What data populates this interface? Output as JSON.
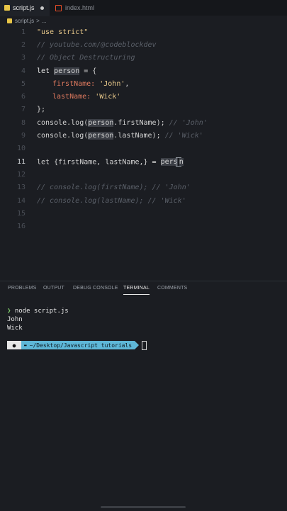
{
  "tabs": [
    {
      "label": "script.js",
      "active": true,
      "modified": true
    },
    {
      "label": "index.html",
      "active": false
    }
  ],
  "breadcrumb": {
    "file": "script.js",
    "sep": ">",
    "more": "..."
  },
  "editor": {
    "lines": [
      {
        "n": "1"
      },
      {
        "n": "2"
      },
      {
        "n": "3"
      },
      {
        "n": "4"
      },
      {
        "n": "5"
      },
      {
        "n": "6"
      },
      {
        "n": "7"
      },
      {
        "n": "8"
      },
      {
        "n": "9"
      },
      {
        "n": "10"
      },
      {
        "n": "11"
      },
      {
        "n": "12"
      },
      {
        "n": "13"
      },
      {
        "n": "14"
      },
      {
        "n": "15"
      },
      {
        "n": "16"
      }
    ],
    "code": {
      "l1": "\"use strict\"",
      "l2": "// youtube.com/@codeblockdev",
      "l3": "// Object Destructuring",
      "l4_kw": "let ",
      "l4_var": "person",
      "l4_rest": " = {",
      "l5_key": "firstName:",
      "l5_val": " 'John'",
      "l5_end": ",",
      "l6_key": "lastName:",
      "l6_val": " 'Wick'",
      "l7": "};",
      "l8_a": "console.log(",
      "l8_b": "person",
      "l8_c": ".firstName); ",
      "l8_cmt": "// 'John'",
      "l9_a": "console.log(",
      "l9_b": "person",
      "l9_c": ".lastName); ",
      "l9_cmt": "// 'Wick'",
      "l11_a": "let {firstName, lastName,} = ",
      "l11_b": "pers",
      "l11_c": "n",
      "l13": "// console.log(firstName); // 'John'",
      "l14": "// console.log(lastName); // 'Wick'"
    },
    "current_line": 11
  },
  "panel": {
    "tabs": [
      "PROBLEMS",
      "OUTPUT",
      "DEBUG CONSOLE",
      "TERMINAL",
      "COMMENTS"
    ],
    "active_tab": "TERMINAL"
  },
  "terminal": {
    "prompt_char": "❯",
    "command": "node script.js",
    "output": [
      "John",
      "Wick"
    ],
    "prompt_path": "~/Desktop/Javascript tutorials",
    "folder_glyph": "▬"
  },
  "colors": {
    "accent": "#5eb7d8",
    "string": "#e9c98b",
    "property": "#e07a5f",
    "comment": "#5a5f68"
  }
}
